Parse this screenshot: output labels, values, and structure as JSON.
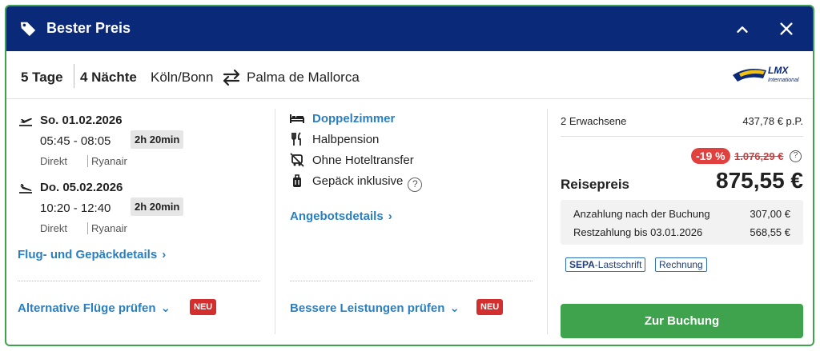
{
  "header": {
    "title": "Bester Preis"
  },
  "route": {
    "days": "5 Tage",
    "nights": "4 Nächte",
    "from": "Köln/Bonn",
    "to": "Palma de Mallorca",
    "logo_text": "LMX International"
  },
  "flights": [
    {
      "date": "So. 01.02.2026",
      "time": "05:45 - 08:05",
      "duration": "2h 20min",
      "type": "Direkt",
      "airline": "Ryanair"
    },
    {
      "date": "Do. 05.02.2026",
      "time": "10:20 - 12:40",
      "duration": "2h 20min",
      "type": "Direkt",
      "airline": "Ryanair"
    }
  ],
  "links": {
    "flight_details": "Flug- und Gepäckdetails",
    "alt_flights": "Alternative Flüge prüfen",
    "offer_details": "Angebotsdetails",
    "better_services": "Bessere Leistungen prüfen",
    "new_badge": "NEU"
  },
  "features": {
    "room": "Doppelzimmer",
    "board": "Halbpension",
    "transfer": "Ohne Hoteltransfer",
    "luggage": "Gepäck inklusive",
    "help": "?"
  },
  "pricing": {
    "travellers": "2 Erwachsene",
    "per_person": "437,78 € p.P.",
    "discount": "-19 %",
    "old_price": "1.076,29 €",
    "label": "Reisepreis",
    "total": "875,55 €",
    "deposit_label": "Anzahlung nach der Buchung",
    "deposit_value": "307,00 €",
    "rest_label": "Restzahlung bis 03.01.2026",
    "rest_value": "568,55 €",
    "pay_sepa_bold": "SEPA",
    "pay_sepa_rest": "-Lastschrift",
    "pay_invoice": "Rechnung",
    "book_button": "Zur Buchung"
  },
  "colors": {
    "header": "#0b2979",
    "accent": "#3fa34d",
    "link": "#2a7fc1",
    "badge": "#d32f2f"
  }
}
